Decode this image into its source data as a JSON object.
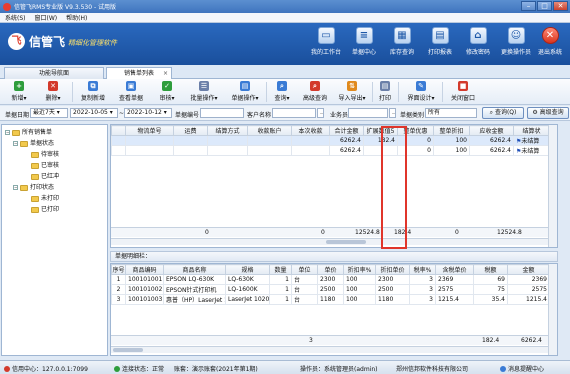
{
  "window": {
    "title": "信管飞RMS专业版 V9.3.530 - 试用版"
  },
  "menu": [
    "系统(S)",
    "窗口(W)",
    "帮助(H)"
  ],
  "banner": {
    "logo_mark": "飞",
    "brand": "信管飞",
    "slogan": "精细化管理软件",
    "items": [
      {
        "label": "我的工作台",
        "icon": "desktop-icon"
      },
      {
        "label": "单据中心",
        "icon": "document-icon"
      },
      {
        "label": "库存查询",
        "icon": "warehouse-icon"
      },
      {
        "label": "打印报表",
        "icon": "printer-icon"
      },
      {
        "label": "修改密码",
        "icon": "lock-icon"
      },
      {
        "label": "更换操作员",
        "icon": "user-switch-icon"
      },
      {
        "label": "退出系统",
        "icon": "exit-icon"
      }
    ]
  },
  "tabs": [
    {
      "label": "功能导航面"
    },
    {
      "label": "销售单列表",
      "active": true
    }
  ],
  "toolbar": [
    {
      "label": "新增",
      "icon": "add-icon",
      "color": "#2e9d3c"
    },
    {
      "label": "删除",
      "icon": "delete-icon",
      "color": "#d33a2c"
    },
    {
      "label": "复制新增",
      "icon": "copy-icon",
      "color": "#3a7bd5"
    },
    {
      "label": "查看单据",
      "icon": "view-icon",
      "color": "#3a7bd5"
    },
    {
      "label": "审核",
      "icon": "approve-icon",
      "color": "#2e9d3c"
    },
    {
      "label": "批量操作",
      "icon": "batch-icon",
      "color": "#6b7fa8"
    },
    {
      "label": "单据操作",
      "icon": "doc-ops-icon",
      "color": "#3a7bd5"
    },
    {
      "label": "查询",
      "icon": "query-icon",
      "color": "#3a7bd5"
    },
    {
      "label": "高级查询",
      "icon": "advanced-query-icon",
      "color": "#d33a2c"
    },
    {
      "label": "导入导出",
      "icon": "import-export-icon",
      "color": "#e08a1e"
    },
    {
      "label": "打印",
      "icon": "print-icon",
      "color": "#6b7fa8"
    },
    {
      "label": "界面设计",
      "icon": "design-icon",
      "color": "#3a7bd5"
    },
    {
      "label": "关闭窗口",
      "icon": "close-window-icon",
      "color": "#d33a2c"
    }
  ],
  "filter": {
    "date_label": "单据日期",
    "date_range": "最近7天",
    "date_from": "2022-10-05",
    "date_to": "2022-10-12",
    "code_label": "单据编号",
    "code_value": "",
    "customer_label": "客户名称",
    "customer_value": "",
    "salesman_label": "业务员",
    "salesman_value": "",
    "type_label": "单据类别",
    "type_value": "所有",
    "query_button": "查询(Q)",
    "advanced_button": "高级查询"
  },
  "tree": {
    "root": "所有销售单",
    "groups": [
      {
        "label": "单据状态",
        "children": [
          "待审核",
          "已审核",
          "已红冲"
        ]
      },
      {
        "label": "打印状态",
        "children": [
          "未打印",
          "已打印"
        ]
      }
    ]
  },
  "main_grid": {
    "columns": [
      "",
      "物流单号",
      "运费",
      "结算方式",
      "收款账户",
      "本次收款",
      "合计金额",
      "扩展数值5",
      "整单优惠",
      "整单折扣",
      "应收金额",
      "结算状"
    ],
    "rows": [
      [
        "",
        "",
        "",
        "",
        "",
        "",
        "6262.4",
        "182.4",
        "0",
        "100",
        "6262.4",
        "未结算"
      ],
      [
        "",
        "",
        "",
        "",
        "",
        "",
        "6262.4",
        "",
        "0",
        "100",
        "6262.4",
        "未结算"
      ]
    ],
    "totals": [
      "0",
      "0",
      "12524.8",
      "182.4",
      "0",
      "12524.8"
    ]
  },
  "detail": {
    "header": "单据明细栏：",
    "columns": [
      "序号",
      "商品编码",
      "商品名称",
      "规格",
      "数量",
      "单位",
      "单价",
      "折扣率%",
      "折扣单价",
      "税率%",
      "含税单价",
      "税额",
      "金额"
    ],
    "rows": [
      [
        "1",
        "100101001",
        "EPSON LQ-630K",
        "LQ-630K",
        "1",
        "台",
        "2300",
        "100",
        "2300",
        "3",
        "2369",
        "69",
        "2369"
      ],
      [
        "2",
        "100101002",
        "EPSON针式打印机",
        "LQ-1600K",
        "1",
        "台",
        "2500",
        "100",
        "2500",
        "3",
        "2575",
        "75",
        "2575"
      ],
      [
        "3",
        "100101003",
        "惠普（HP）LaserJet 1020",
        "LaserJet 1020",
        "1",
        "台",
        "1180",
        "100",
        "1180",
        "3",
        "1215.4",
        "35.4",
        "1215.4"
      ]
    ],
    "totals": [
      "3",
      "182.4",
      "6262.4"
    ]
  },
  "status": {
    "server": "信用中心：127.0.0.1:7099",
    "connection": "连接状态：正常",
    "account": "账套：演示账套(2021年第1期)",
    "operator": "操作员：系统管理员(admin)",
    "company": "郑州信邦软件科技有限公司",
    "message_center": "消息提醒中心"
  },
  "colors": {
    "highlight_box": "#e0352b",
    "banner": "#2a69bf"
  }
}
